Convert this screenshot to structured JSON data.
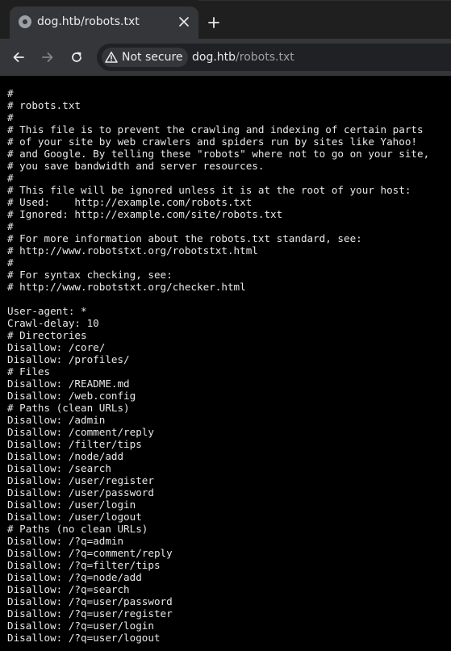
{
  "tab": {
    "title": "dog.htb/robots.txt",
    "favicon": "globe-icon",
    "close_icon": "close-icon",
    "new_tab_icon": "plus-icon"
  },
  "toolbar": {
    "back_icon": "arrow-left-icon",
    "forward_icon": "arrow-right-icon",
    "reload_icon": "reload-icon",
    "security_icon": "warning-triangle-icon",
    "security_label": "Not secure",
    "url_host": "dog.htb",
    "url_path": "/robots.txt"
  },
  "colors": {
    "tab_strip": "#1f1f1f",
    "toolbar": "#35363a",
    "omnibox": "#202124",
    "page_background": "#000000",
    "page_text": "#e8e8e8",
    "url_path": "#9aa0a6"
  },
  "document": {
    "content": "#\n# robots.txt\n#\n# This file is to prevent the crawling and indexing of certain parts\n# of your site by web crawlers and spiders run by sites like Yahoo!\n# and Google. By telling these \"robots\" where not to go on your site,\n# you save bandwidth and server resources.\n#\n# This file will be ignored unless it is at the root of your host:\n# Used:    http://example.com/robots.txt\n# Ignored: http://example.com/site/robots.txt\n#\n# For more information about the robots.txt standard, see:\n# http://www.robotstxt.org/robotstxt.html\n#\n# For syntax checking, see:\n# http://www.robotstxt.org/checker.html\n\nUser-agent: *\nCrawl-delay: 10\n# Directories\nDisallow: /core/\nDisallow: /profiles/\n# Files\nDisallow: /README.md\nDisallow: /web.config\n# Paths (clean URLs)\nDisallow: /admin\nDisallow: /comment/reply\nDisallow: /filter/tips\nDisallow: /node/add\nDisallow: /search\nDisallow: /user/register\nDisallow: /user/password\nDisallow: /user/login\nDisallow: /user/logout\n# Paths (no clean URLs)\nDisallow: /?q=admin\nDisallow: /?q=comment/reply\nDisallow: /?q=filter/tips\nDisallow: /?q=node/add\nDisallow: /?q=search\nDisallow: /?q=user/password\nDisallow: /?q=user/register\nDisallow: /?q=user/login\nDisallow: /?q=user/logout"
  }
}
